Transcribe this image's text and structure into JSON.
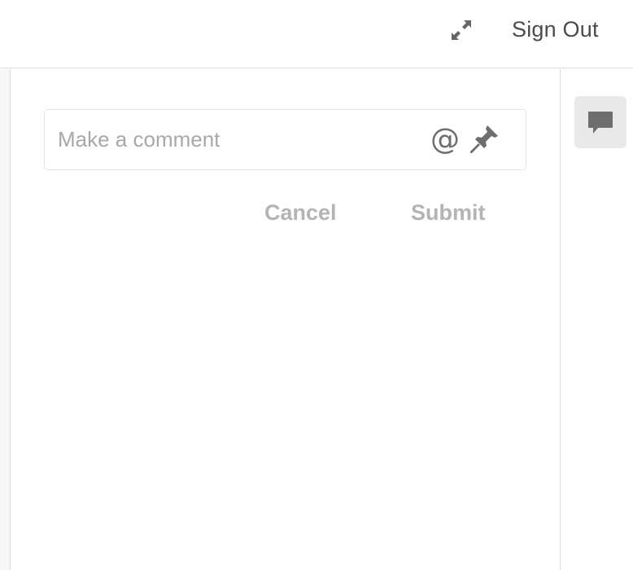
{
  "header": {
    "fullscreen_icon": "expand-arrows-icon",
    "signout_label": "Sign Out"
  },
  "comment": {
    "placeholder": "Make a comment",
    "value": "",
    "mention_symbol": "@",
    "pin_icon": "pushpin-icon",
    "cancel_label": "Cancel",
    "submit_label": "Submit"
  },
  "right_rail": {
    "comments_icon": "comment-bubble-icon"
  },
  "colors": {
    "icon_gray": "#6e6e6e",
    "disabled_text": "#b4b4b4",
    "placeholder_text": "#a8a8a8",
    "rail_button_bg": "#e9e9e9",
    "border": "#dcdcdc"
  }
}
